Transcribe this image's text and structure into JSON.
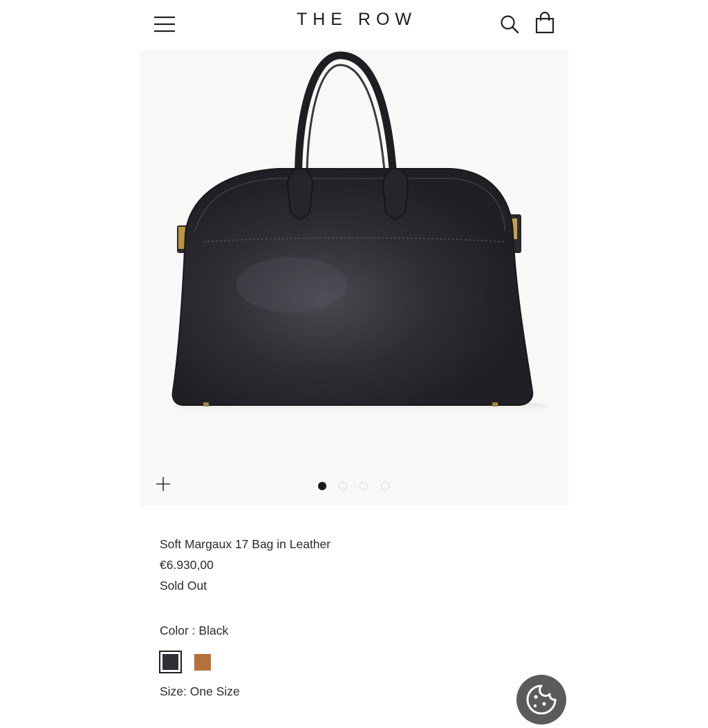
{
  "header": {
    "brand": "THE ROW",
    "menu_icon": "hamburger-menu-icon",
    "search_icon": "search-icon",
    "cart_icon": "shopping-bag-icon"
  },
  "gallery": {
    "image_alt": "Soft Margaux 17 Bag in Leather",
    "zoom_icon": "plus-icon",
    "slides": 4,
    "active_slide": 1
  },
  "product": {
    "name": "Soft Margaux 17 Bag in Leather",
    "price": "€6.930,00",
    "availability": "Sold Out",
    "color_label": "Color : Black",
    "colors": [
      {
        "name": "Black",
        "hex": "#2f2f35",
        "selected": true
      },
      {
        "name": "Tan",
        "hex": "#b5713a",
        "selected": false
      }
    ],
    "size_label": "Size: One Size"
  },
  "cookie": {
    "icon": "cookie-icon"
  },
  "colors": {
    "text": "#222222",
    "gallery_bg": "#f8f8f6",
    "bag": "#2c2b31",
    "cookie_button": "#5b5b5b"
  }
}
